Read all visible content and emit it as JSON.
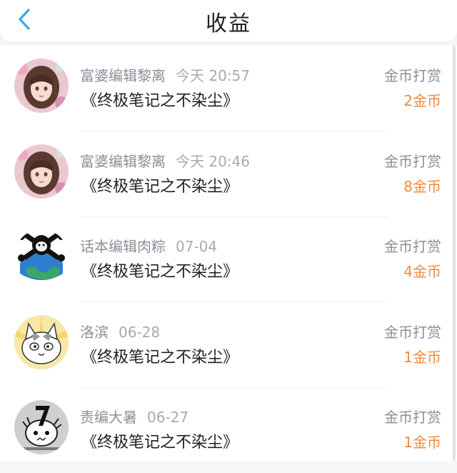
{
  "header": {
    "title": "收益"
  },
  "items": [
    {
      "name": "富婆编辑黎离",
      "time": "今天 20:57",
      "book": "《终极笔记之不染尘》",
      "type": "金币打赏",
      "amount": "2金币",
      "avatar": "anime-girl-avatar"
    },
    {
      "name": "富婆编辑黎离",
      "time": "今天 20:46",
      "book": "《终极笔记之不染尘》",
      "type": "金币打赏",
      "amount": "8金币",
      "avatar": "anime-girl-avatar"
    },
    {
      "name": "话本编辑肉粽",
      "time": "07-04",
      "book": "《终极笔记之不染尘》",
      "type": "金币打赏",
      "amount": "4金币",
      "avatar": "skull-globe-avatar"
    },
    {
      "name": "洛滨",
      "time": "06-28",
      "book": "《终极笔记之不染尘》",
      "type": "金币打赏",
      "amount": "1金币",
      "avatar": "cat-avatar"
    },
    {
      "name": "责编大暑",
      "time": "06-27",
      "book": "《终极笔记之不染尘》",
      "type": "金币打赏",
      "amount": "1金币",
      "avatar": "chainsaw-dog-avatar"
    }
  ],
  "colors": {
    "amount": "#f08a3c",
    "back_arrow": "#3ba8e6"
  }
}
